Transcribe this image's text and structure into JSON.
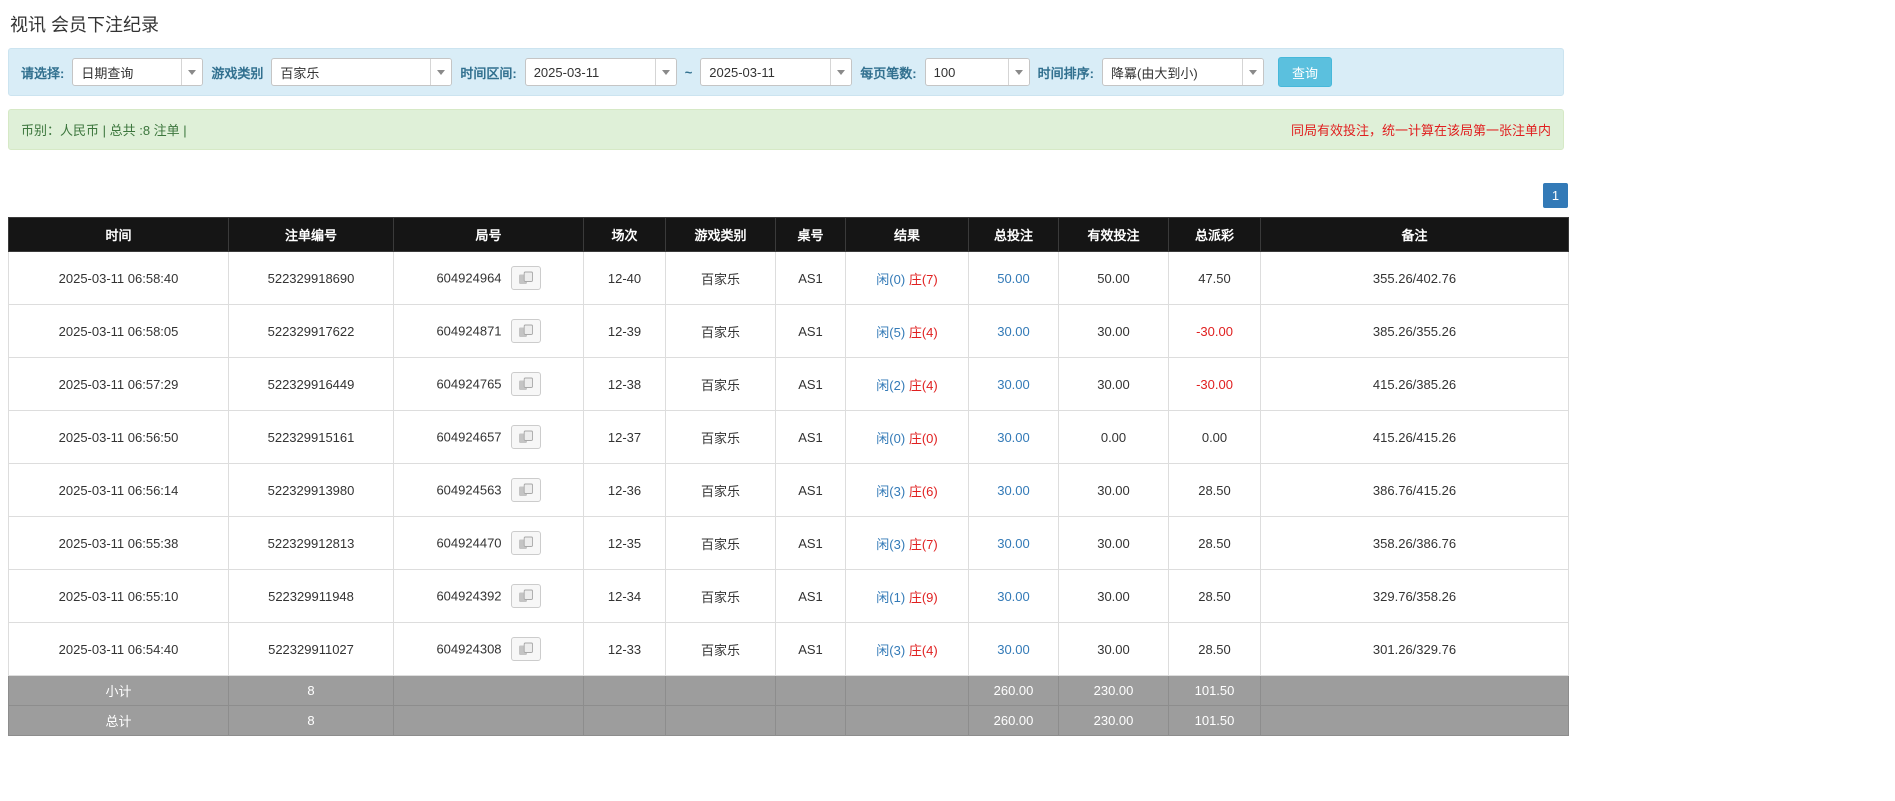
{
  "page": {
    "title": "视讯 会员下注纪录"
  },
  "filters": {
    "select_label": "请选择:",
    "select_value": "日期查询",
    "game_type_label": "游戏类别",
    "game_type_value": "百家乐",
    "date_range_label": "时间区间:",
    "date_from": "2025-03-11",
    "date_separator": "~",
    "date_to": "2025-03-11",
    "page_size_label": "每页笔数:",
    "page_size_value": "100",
    "sort_label": "时间排序:",
    "sort_value": "降冪(由大到小)",
    "search_button": "查询"
  },
  "summary": {
    "info": "币别：人民币 | 总共 :8 注单 |",
    "notice": "同局有效投注，统一计算在该局第一张注单内"
  },
  "pagination": {
    "current": "1"
  },
  "table": {
    "columns": [
      "时间",
      "注单编号",
      "局号",
      "场次",
      "游戏类别",
      "桌号",
      "结果",
      "总投注",
      "有效投注",
      "总派彩",
      "备注"
    ],
    "rows": [
      {
        "time": "2025-03-11 06:58:40",
        "bet_id": "522329918690",
        "round": "604924964",
        "session": "12-40",
        "game": "百家乐",
        "table_no": "AS1",
        "result_player": "闲(0)",
        "result_banker": "庄(7)",
        "total_bet": "50.00",
        "valid_bet": "50.00",
        "payout": "47.50",
        "note": "355.26/402.76"
      },
      {
        "time": "2025-03-11 06:58:05",
        "bet_id": "522329917622",
        "round": "604924871",
        "session": "12-39",
        "game": "百家乐",
        "table_no": "AS1",
        "result_player": "闲(5)",
        "result_banker": "庄(4)",
        "total_bet": "30.00",
        "valid_bet": "30.00",
        "payout": "-30.00",
        "note": "385.26/355.26"
      },
      {
        "time": "2025-03-11 06:57:29",
        "bet_id": "522329916449",
        "round": "604924765",
        "session": "12-38",
        "game": "百家乐",
        "table_no": "AS1",
        "result_player": "闲(2)",
        "result_banker": "庄(4)",
        "total_bet": "30.00",
        "valid_bet": "30.00",
        "payout": "-30.00",
        "note": "415.26/385.26"
      },
      {
        "time": "2025-03-11 06:56:50",
        "bet_id": "522329915161",
        "round": "604924657",
        "session": "12-37",
        "game": "百家乐",
        "table_no": "AS1",
        "result_player": "闲(0)",
        "result_banker": "庄(0)",
        "total_bet": "30.00",
        "valid_bet": "0.00",
        "payout": "0.00",
        "note": "415.26/415.26"
      },
      {
        "time": "2025-03-11 06:56:14",
        "bet_id": "522329913980",
        "round": "604924563",
        "session": "12-36",
        "game": "百家乐",
        "table_no": "AS1",
        "result_player": "闲(3)",
        "result_banker": "庄(6)",
        "total_bet": "30.00",
        "valid_bet": "30.00",
        "payout": "28.50",
        "note": "386.76/415.26"
      },
      {
        "time": "2025-03-11 06:55:38",
        "bet_id": "522329912813",
        "round": "604924470",
        "session": "12-35",
        "game": "百家乐",
        "table_no": "AS1",
        "result_player": "闲(3)",
        "result_banker": "庄(7)",
        "total_bet": "30.00",
        "valid_bet": "30.00",
        "payout": "28.50",
        "note": "358.26/386.76"
      },
      {
        "time": "2025-03-11 06:55:10",
        "bet_id": "522329911948",
        "round": "604924392",
        "session": "12-34",
        "game": "百家乐",
        "table_no": "AS1",
        "result_player": "闲(1)",
        "result_banker": "庄(9)",
        "total_bet": "30.00",
        "valid_bet": "30.00",
        "payout": "28.50",
        "note": "329.76/358.26"
      },
      {
        "time": "2025-03-11 06:54:40",
        "bet_id": "522329911027",
        "round": "604924308",
        "session": "12-33",
        "game": "百家乐",
        "table_no": "AS1",
        "result_player": "闲(3)",
        "result_banker": "庄(4)",
        "total_bet": "30.00",
        "valid_bet": "30.00",
        "payout": "28.50",
        "note": "301.26/329.76"
      }
    ],
    "footer": [
      {
        "label": "小计",
        "count": "8",
        "total_bet": "260.00",
        "valid_bet": "230.00",
        "payout": "101.50"
      },
      {
        "label": "总计",
        "count": "8",
        "total_bet": "260.00",
        "valid_bet": "230.00",
        "payout": "101.50"
      }
    ]
  },
  "colors": {
    "accent_blue": "#337ab7",
    "search_button_bg": "#5bc0de",
    "player_blue": "#337ab7",
    "banker_red": "#e02020",
    "negative_red": "#e02020",
    "notice_red": "#e02020",
    "filter_bar_bg": "#d9edf7",
    "summary_bar_bg": "#dff0d8",
    "table_header_bg": "#151515",
    "table_footer_bg": "#9d9d9d"
  }
}
